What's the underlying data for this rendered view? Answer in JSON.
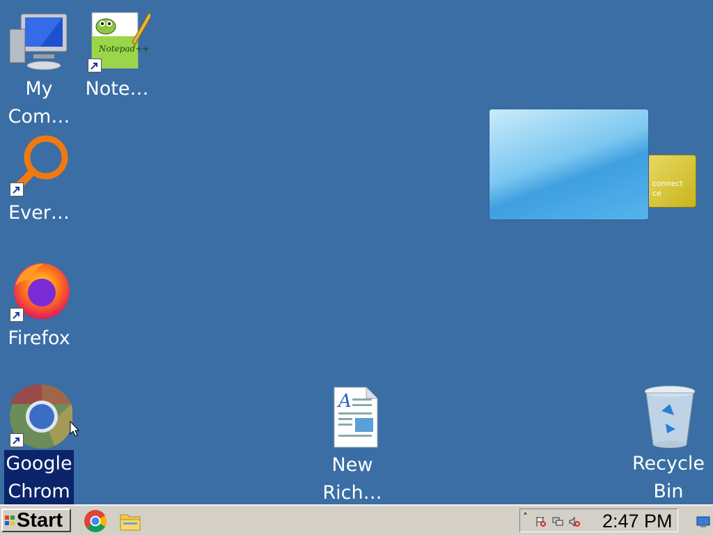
{
  "desktop": {
    "icons": [
      {
        "id": "my-computer",
        "label": "My\nCom…"
      },
      {
        "id": "notepadpp",
        "label": "Note…",
        "image_text": "Notepad++"
      },
      {
        "id": "everything",
        "label": "Ever…"
      },
      {
        "id": "firefox",
        "label": "Firefox"
      },
      {
        "id": "chrome",
        "label": "Google\nChrom",
        "selected": true
      },
      {
        "id": "wordpad",
        "label": "New\nRich…"
      },
      {
        "id": "recycle-bin",
        "label": "Recycle\nBin"
      }
    ],
    "gadgets": {
      "card_text_1": "connect",
      "card_text_2": "ce"
    }
  },
  "taskbar": {
    "start_label": "Start",
    "quick_launch": [
      "chrome-icon",
      "explorer-icon"
    ],
    "tray": {
      "expand_label": "˄",
      "icons": [
        "action-center-flag-icon",
        "network-icon",
        "volume-icon"
      ],
      "clock": "2:47 PM"
    }
  },
  "colors": {
    "desktop": "#3a6ea5",
    "taskbar": "#d4d0c8",
    "selection": "#0b246a"
  }
}
